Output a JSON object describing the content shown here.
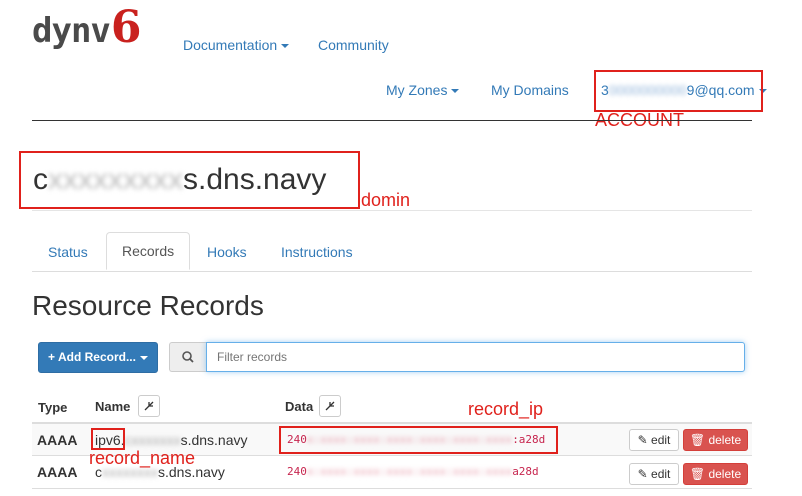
{
  "logo": {
    "main": "dynv",
    "digit": "6"
  },
  "nav": {
    "documentation": "Documentation",
    "community": "Community",
    "my_zones": "My Zones",
    "my_domains": "My Domains",
    "account_prefix": "3",
    "account_masked": "0000000000",
    "account_suffix": "9@qq.com"
  },
  "zone": {
    "prefix": "c",
    "masked": "xxxxxxxxx",
    "suffix": "s.dns.navy"
  },
  "tabs": [
    "Status",
    "Records",
    "Hooks",
    "Instructions"
  ],
  "section_title": "Resource Records",
  "toolbar": {
    "add_record": "+ Add Record...",
    "filter_placeholder": "Filter records"
  },
  "table": {
    "headers": {
      "type": "Type",
      "name": "Name",
      "data": "Data"
    },
    "rows": [
      {
        "type": "AAAA",
        "name_prefix": "ipv6.",
        "name_masked": "cxxxxxxx",
        "name_suffix": "s.dns.navy",
        "data_prefix": "240",
        "data_masked": "x:xxxx:xxxx:xxxx:xxxx:xxxx:xxxx",
        "data_suffix": ":a28d"
      },
      {
        "type": "AAAA",
        "name_prefix": "c",
        "name_masked": "xxxxxxxx",
        "name_suffix": "s.dns.navy",
        "data_prefix": "240",
        "data_masked": "x:xxxx:xxxx:xxxx:xxxx:xxxx:xxxx",
        "data_suffix": "a28d"
      }
    ],
    "edit_label": "edit",
    "delete_label": "delete"
  },
  "annotations": {
    "account": "ACCOUNT",
    "domin": "domin",
    "record_ip": "record_ip",
    "record_name": "record_name"
  },
  "colors": {
    "link": "#337ab7",
    "annotation": "#e0211c",
    "danger": "#d9534f",
    "code": "#c7254e"
  }
}
